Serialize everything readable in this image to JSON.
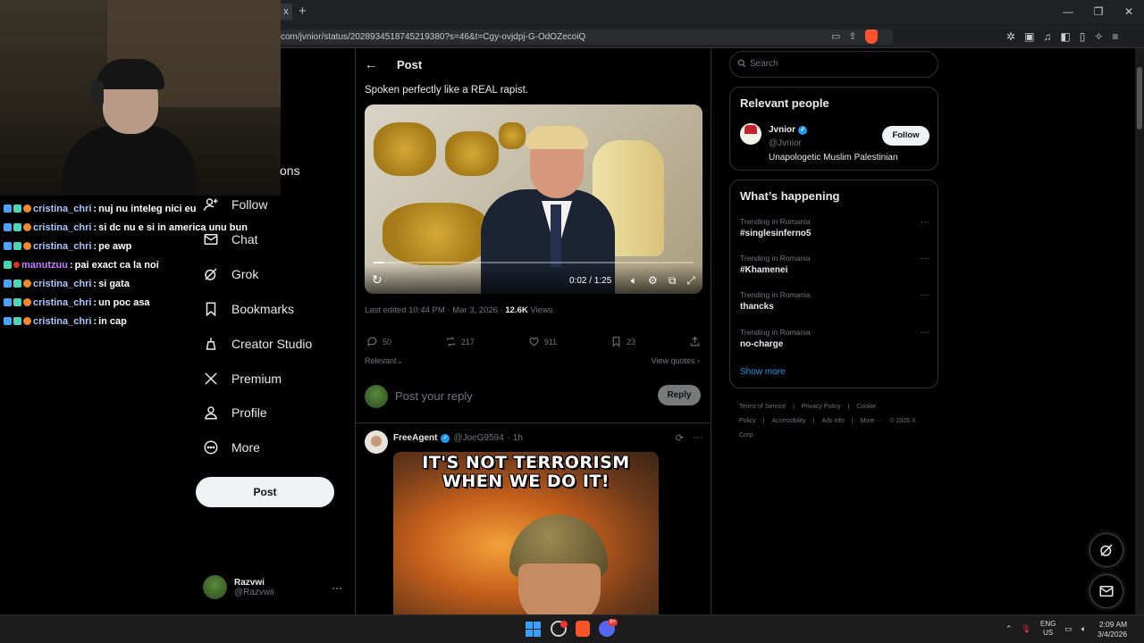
{
  "browser": {
    "url": "com/jvnior/status/2028934518745219380?s=46&t=Cgy-ovjdpj-G-OdOZecoiQ",
    "new_tab": "+",
    "tab_close": "x",
    "win_controls": [
      "—",
      "❐",
      "✕"
    ]
  },
  "chat": [
    {
      "user": "cristina_chri",
      "msg": "nuj nu inteleg nici eu",
      "color": "blue"
    },
    {
      "user": "cristina_chri",
      "msg": "si dc nu e si in america unu bun",
      "color": "blue"
    },
    {
      "user": "cristina_chri",
      "msg": "pe awp",
      "color": "blue"
    },
    {
      "user": "manutzuu",
      "msg": "pai exact ca la noi",
      "color": "purple"
    },
    {
      "user": "cristina_chri",
      "msg": "si gata",
      "color": "blue"
    },
    {
      "user": "cristina_chri",
      "msg": "un poc asa",
      "color": "blue"
    },
    {
      "user": "cristina_chri",
      "msg": "in cap",
      "color": "blue"
    }
  ],
  "nav": {
    "partial": "ons",
    "items": [
      "Follow",
      "Chat",
      "Grok",
      "Bookmarks",
      "Creator Studio",
      "Premium",
      "Profile",
      "More"
    ],
    "post_button": "Post",
    "account": {
      "name": "Razvwi",
      "handle": "@Razvwii"
    },
    "more_dots": "···"
  },
  "main": {
    "back": "←",
    "title": "Post",
    "text": "Spoken perfectly like a REAL rapist.",
    "video": {
      "time": "0:02 / 1:25",
      "progress_fraction": 0.03
    },
    "meta": {
      "edited": "Last edited 10:44 PM · Mar 3, 2026 · ",
      "views_count": "12.6K",
      "views_label": " Views"
    },
    "actions": {
      "replies": "50",
      "reposts": "217",
      "likes": "911",
      "bookmarks": "23"
    },
    "relevant": "Relevant",
    "view_quotes": "View quotes",
    "reply_placeholder": "Post your reply",
    "reply_button": "Reply",
    "reply_tweet": {
      "name": "FreeAgent",
      "handle": "@JoeG9594",
      "time": "· 1h",
      "meme_text": "IT'S NOT TERRORISM WHEN WE DO IT!"
    }
  },
  "right": {
    "search_placeholder": "Search",
    "relevant_title": "Relevant people",
    "person": {
      "name": "Jvnior",
      "handle": "@Jvnior",
      "bio": "Unapologetic Muslim Palestinian",
      "follow": "Follow"
    },
    "happening_title": "What’s happening",
    "trends": [
      {
        "context": "Trending in Romania",
        "name": "#singlesinferno5"
      },
      {
        "context": "Trending in Romania",
        "name": "#Khamenei"
      },
      {
        "context": "Trending in Romania",
        "name": "thancks"
      },
      {
        "context": "Trending in Romania",
        "name": "no-charge"
      }
    ],
    "show_more": "Show more",
    "footer": [
      "Terms of Service",
      "|",
      "Privacy Policy",
      "|",
      "Cookie Policy",
      "|",
      "Accessibility",
      "|",
      "Ads info",
      "|",
      "More ···",
      "© 2026 X Corp."
    ]
  },
  "taskbar": {
    "lang_1": "ENG",
    "lang_2": "US",
    "time": "2:09 AM",
    "date": "3/4/2026",
    "discord_badge": "9+"
  },
  "colors": {
    "accent": "#1d9bf0",
    "bg": "#000000",
    "brave": "#fb542b"
  }
}
